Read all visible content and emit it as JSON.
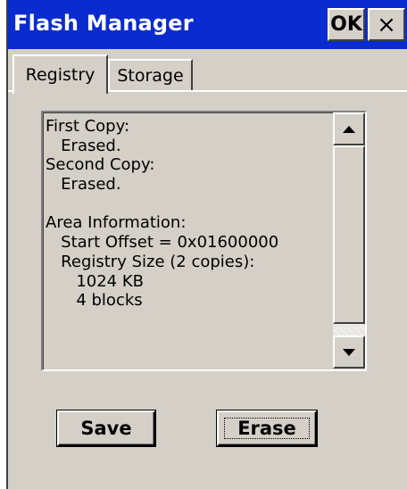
{
  "window": {
    "title": "Flash Manager",
    "ok_label": "OK",
    "close_label": "×",
    "colors": {
      "titlebar": "#0a2bd0",
      "face": "#d4d0c8"
    }
  },
  "tabs": [
    {
      "label": "Registry",
      "selected": true
    },
    {
      "label": "Storage",
      "selected": false
    }
  ],
  "info_lines": [
    "First Copy:",
    "   Erased.",
    "Second Copy:",
    "   Erased.",
    "",
    "Area Information:",
    "   Start Offset = 0x01600000",
    "   Registry Size (2 copies):",
    "      1024 KB",
    "      4 blocks"
  ],
  "buttons": {
    "save_label": "Save",
    "erase_label": "Erase"
  },
  "icons": {
    "scroll_up": "triangle-up-icon",
    "scroll_down": "triangle-down-icon"
  }
}
